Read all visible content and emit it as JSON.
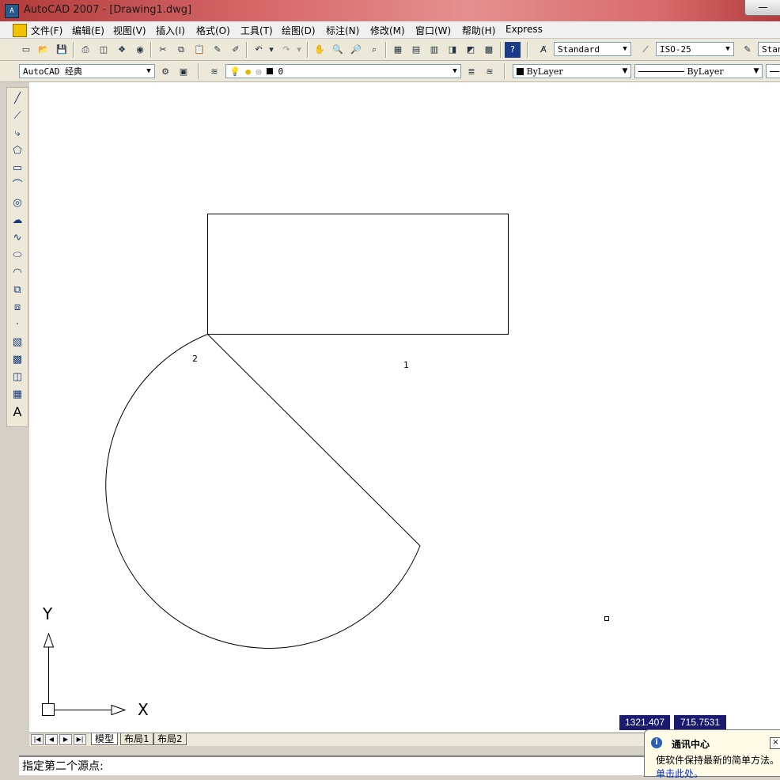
{
  "window": {
    "title": "AutoCAD 2007 - [Drawing1.dwg]",
    "app_icon": "A"
  },
  "menu": {
    "items": [
      "文件(F)",
      "编辑(E)",
      "视图(V)",
      "插入(I)",
      "格式(O)",
      "工具(T)",
      "绘图(D)",
      "标注(N)",
      "修改(M)",
      "窗口(W)",
      "帮助(H)",
      "Express"
    ]
  },
  "toolbar1": {
    "text_style": "Standard",
    "dim_style": "ISO-25",
    "table_style": "Stan"
  },
  "toolbar2": {
    "workspace": "AutoCAD 经典",
    "layer": "0",
    "color": "ByLayer",
    "linetype": "ByLayer"
  },
  "drawing": {
    "label_1": "1",
    "label_2": "2",
    "ucs_y": "Y",
    "ucs_x": "X"
  },
  "status": {
    "coord_x": "1321.407",
    "coord_y": "715.7531"
  },
  "layout_tabs": [
    "模型",
    "布局1",
    "布局2"
  ],
  "command_line": {
    "prompt": "指定第二个源点:"
  },
  "notification": {
    "icon": "i",
    "title": "通讯中心",
    "text": "使软件保持最新的简单方法。",
    "link": "单击此处。",
    "close": "×"
  },
  "colors": {
    "title_bar": "#c94f4f",
    "coord_bg": "#1a1a6e",
    "canvas": "#ffffff"
  }
}
